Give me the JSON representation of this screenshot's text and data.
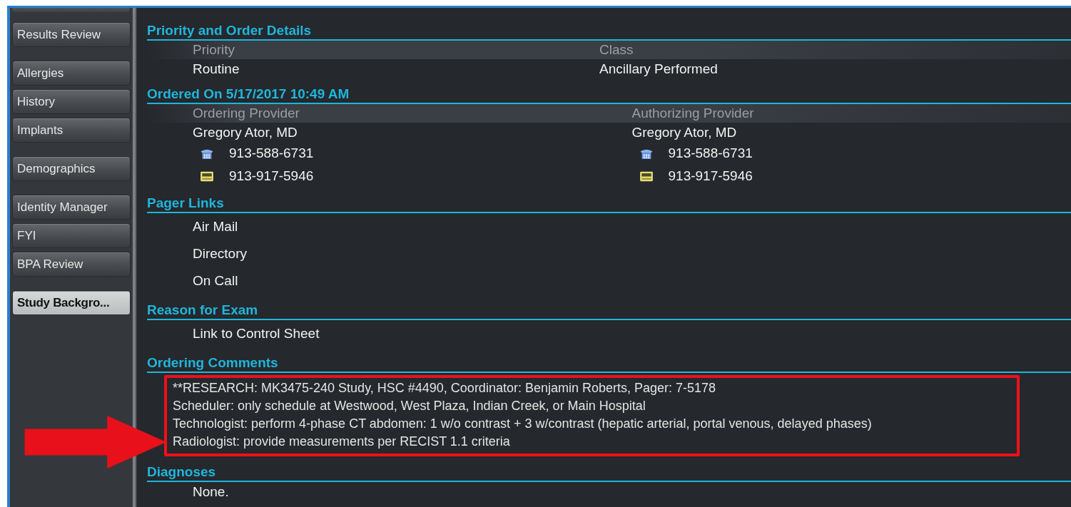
{
  "sidebar": {
    "groups": [
      [
        {
          "label": "Results Review",
          "selected": false
        }
      ],
      [
        {
          "label": "Allergies",
          "selected": false
        },
        {
          "label": "History",
          "selected": false
        },
        {
          "label": "Implants",
          "selected": false
        }
      ],
      [
        {
          "label": "Demographics",
          "selected": false
        }
      ],
      [
        {
          "label": "Identity Manager",
          "selected": false
        },
        {
          "label": "FYI",
          "selected": false
        },
        {
          "label": "BPA Review",
          "selected": false
        }
      ],
      [
        {
          "label": "Study Backgro...",
          "selected": true
        }
      ]
    ]
  },
  "sections": [
    {
      "title": "Priority and Order Details",
      "kind": "fields",
      "columns": [
        {
          "label": "Priority",
          "value": "Routine"
        },
        {
          "label": "Class",
          "value": "Ancillary Performed"
        }
      ]
    },
    {
      "title": "Ordered On 5/17/2017 10:49 AM",
      "kind": "providers",
      "providers": [
        {
          "label": "Ordering Provider",
          "name": "Gregory Ator, MD",
          "phone": "913-588-6731",
          "pager": "913-917-5946"
        },
        {
          "label": "Authorizing Provider",
          "name": "Gregory Ator, MD",
          "phone": "913-588-6731",
          "pager": "913-917-5946"
        }
      ]
    },
    {
      "title": "Pager Links",
      "kind": "links",
      "links": [
        "Air Mail",
        "Directory",
        "On Call"
      ]
    },
    {
      "title": "Reason for Exam",
      "kind": "links",
      "links": [
        "Link to Control Sheet"
      ]
    },
    {
      "title": "Ordering Comments",
      "kind": "comments",
      "highlighted": true,
      "lines": [
        "**RESEARCH: MK3475-240 Study, HSC #4490, Coordinator: Benjamin Roberts, Pager: 7-5178",
        "Scheduler: only schedule at Westwood, West Plaza, Indian Creek, or Main Hospital",
        "Technologist: perform 4-phase CT abdomen: 1 w/o contrast + 3 w/contrast (hepatic arterial, portal venous, delayed phases)",
        "Radiologist: provide measurements per RECIST 1.1 criteria"
      ]
    },
    {
      "title": "Diagnoses",
      "kind": "text",
      "lines": [
        "None."
      ]
    }
  ]
}
